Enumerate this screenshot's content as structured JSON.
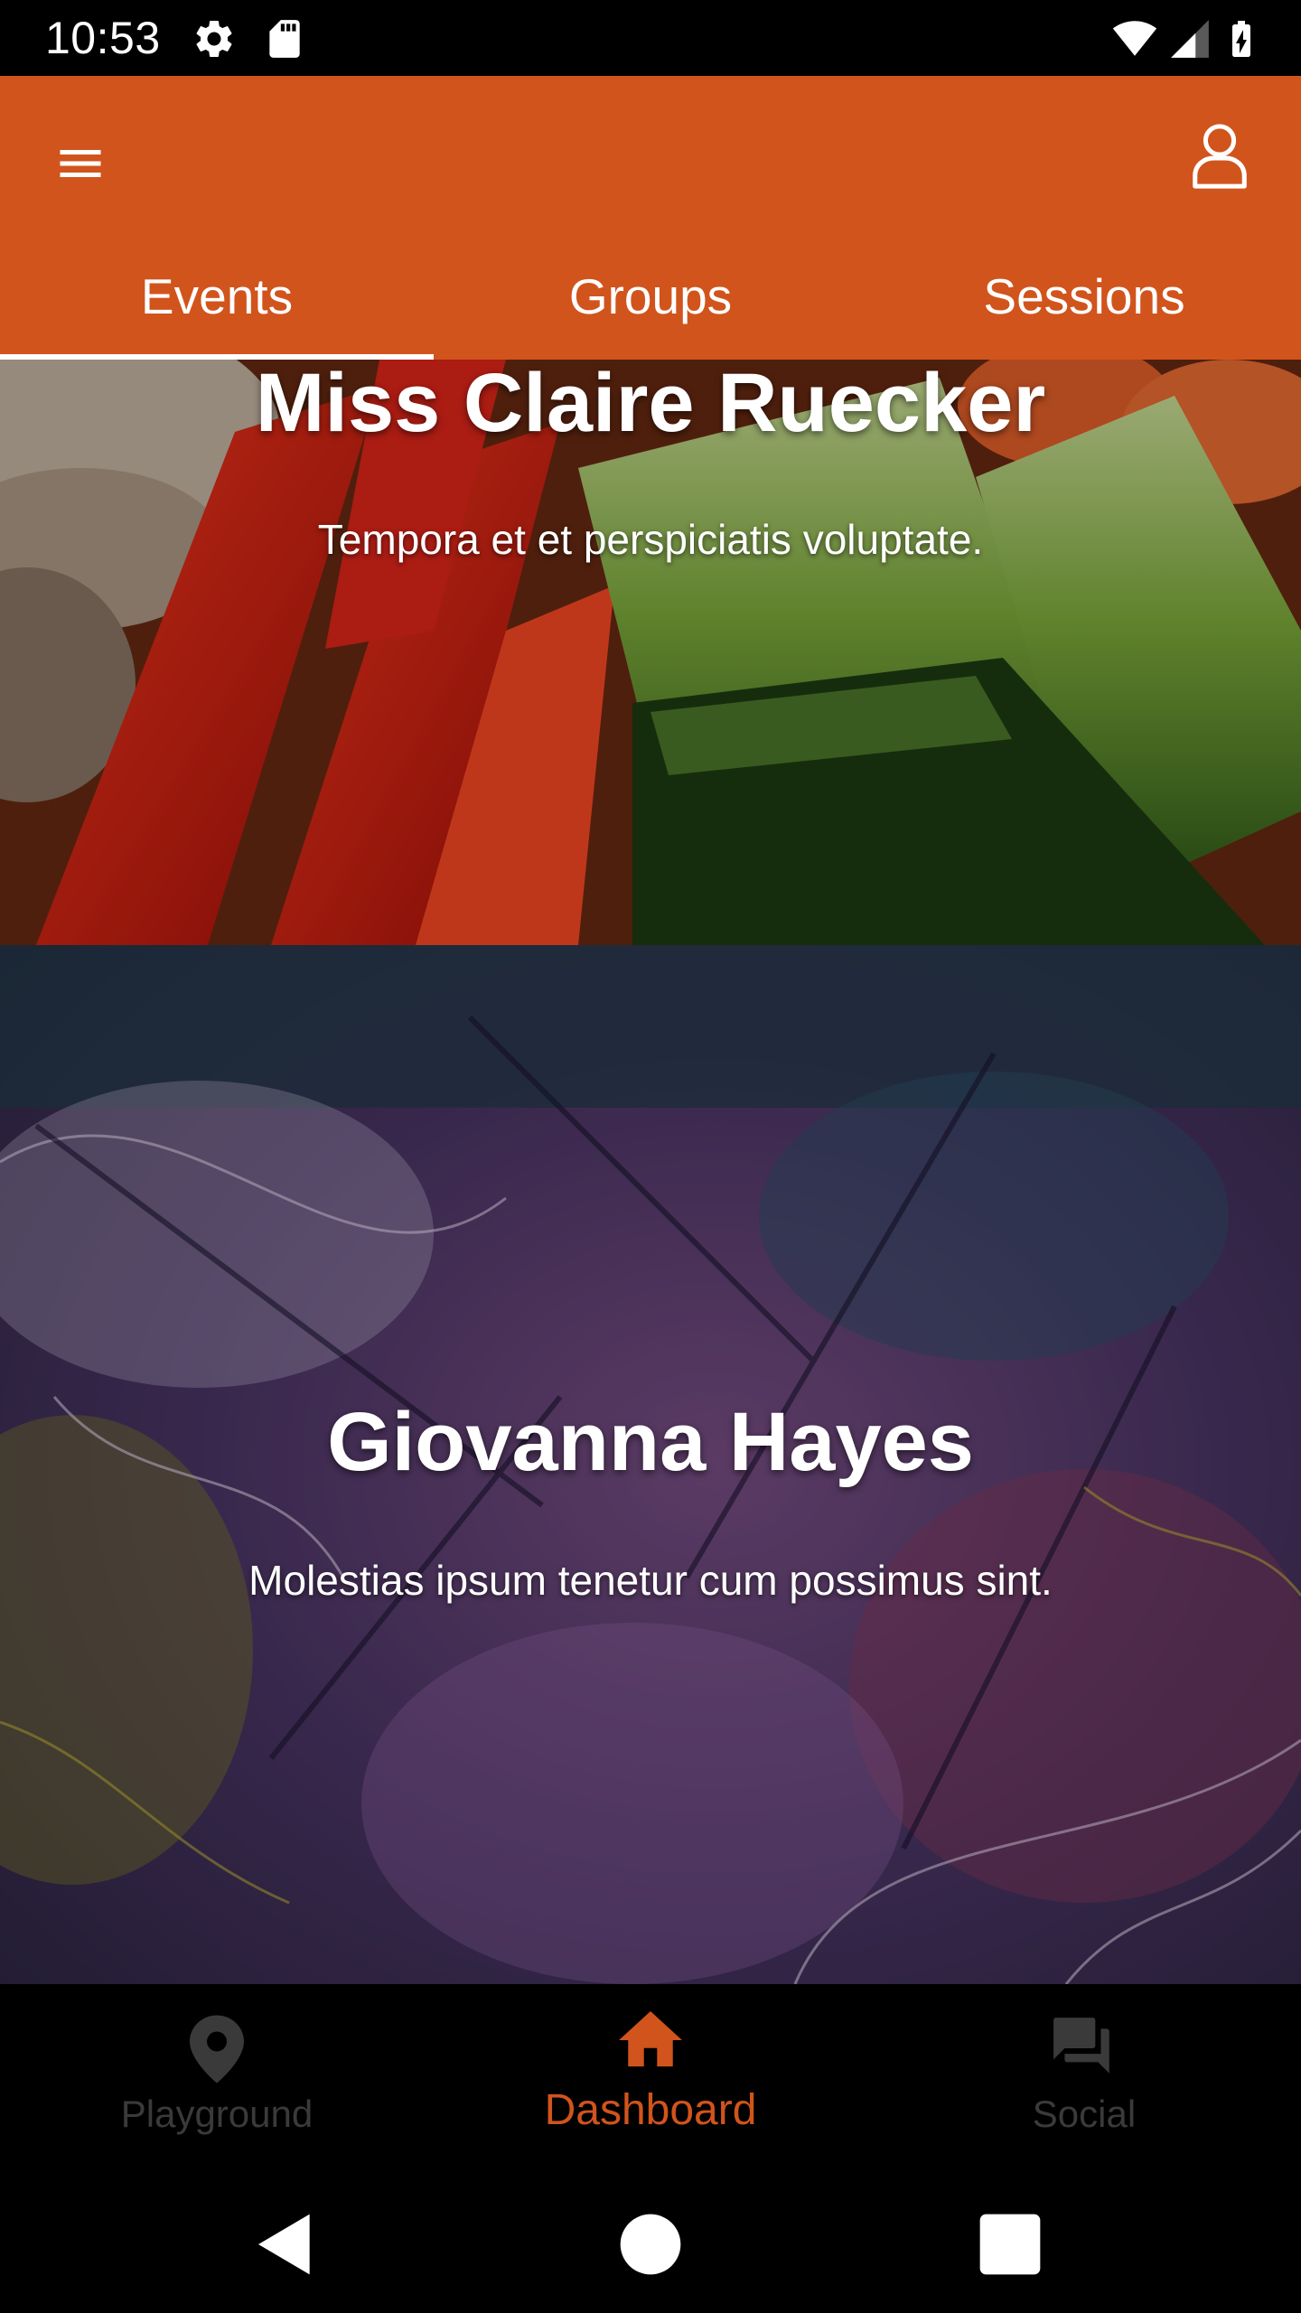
{
  "status_bar": {
    "time": "10:53",
    "icons": [
      "settings-icon",
      "sd-card-icon",
      "wifi-icon",
      "signal-icon",
      "battery-charging-icon"
    ]
  },
  "app_bar": {
    "menu_icon": "hamburger-menu-icon",
    "account_icon": "user-account-icon",
    "background_color": "#d1541c",
    "tabs": [
      {
        "label": "Events",
        "selected": true
      },
      {
        "label": "Groups",
        "selected": false
      },
      {
        "label": "Sessions",
        "selected": false
      }
    ]
  },
  "cards": [
    {
      "title": "Miss Claire Ruecker",
      "subtitle": "Tempora et et perspiciatis voluptate.",
      "image": "vegetables-photo"
    },
    {
      "title": "Giovanna Hayes",
      "subtitle": "Molestias ipsum tenetur cum possimus sint.",
      "image": "abstract-fractal-art"
    }
  ],
  "bottom_nav": {
    "items": [
      {
        "label": "Playground",
        "icon": "location-pin-icon",
        "selected": false
      },
      {
        "label": "Dashboard",
        "icon": "home-icon",
        "selected": true
      },
      {
        "label": "Social",
        "icon": "chat-bubble-icon",
        "selected": false
      }
    ],
    "active_color": "#d1541c",
    "inactive_color": "#3a3a3a"
  },
  "system_nav": {
    "icons": [
      "back-icon",
      "home-circle-icon",
      "recents-icon"
    ]
  }
}
